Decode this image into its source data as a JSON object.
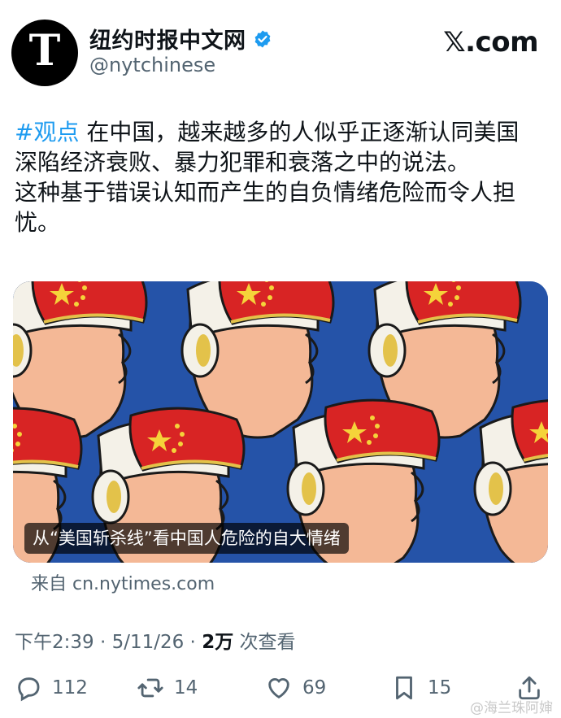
{
  "account": {
    "display_name": "纽约时报中文网",
    "handle": "@nytchinese",
    "avatar_letter": "T",
    "verified_icon": "verified-badge-icon"
  },
  "platform": {
    "logo_text": "𝕏.com"
  },
  "tweet": {
    "hashtag": "#观点",
    "line1": " 在中国，越来越多的人似乎正逐渐认同美国",
    "line2": "深陷经济衰败、暴力犯罪和衰落之中的说法。",
    "line3": "这种基于错误认知而产生的自负情绪危险而令人担",
    "line4": "忧。"
  },
  "card": {
    "caption": "从“美国斩杀线”看中国人危险的自大情绪",
    "source": "来自 cn.nytimes.com"
  },
  "meta": {
    "time": "下午2:39 · 5/11/26 · ",
    "views_count": "2万",
    "views_label": " 次查看"
  },
  "actions": {
    "reply": "112",
    "retweet": "14",
    "like": "69",
    "bookmark": "15"
  },
  "watermark": "@海兰珠阿婶",
  "colors": {
    "link": "#1d9bf0",
    "secondary": "#536471",
    "text": "#0f1419"
  }
}
